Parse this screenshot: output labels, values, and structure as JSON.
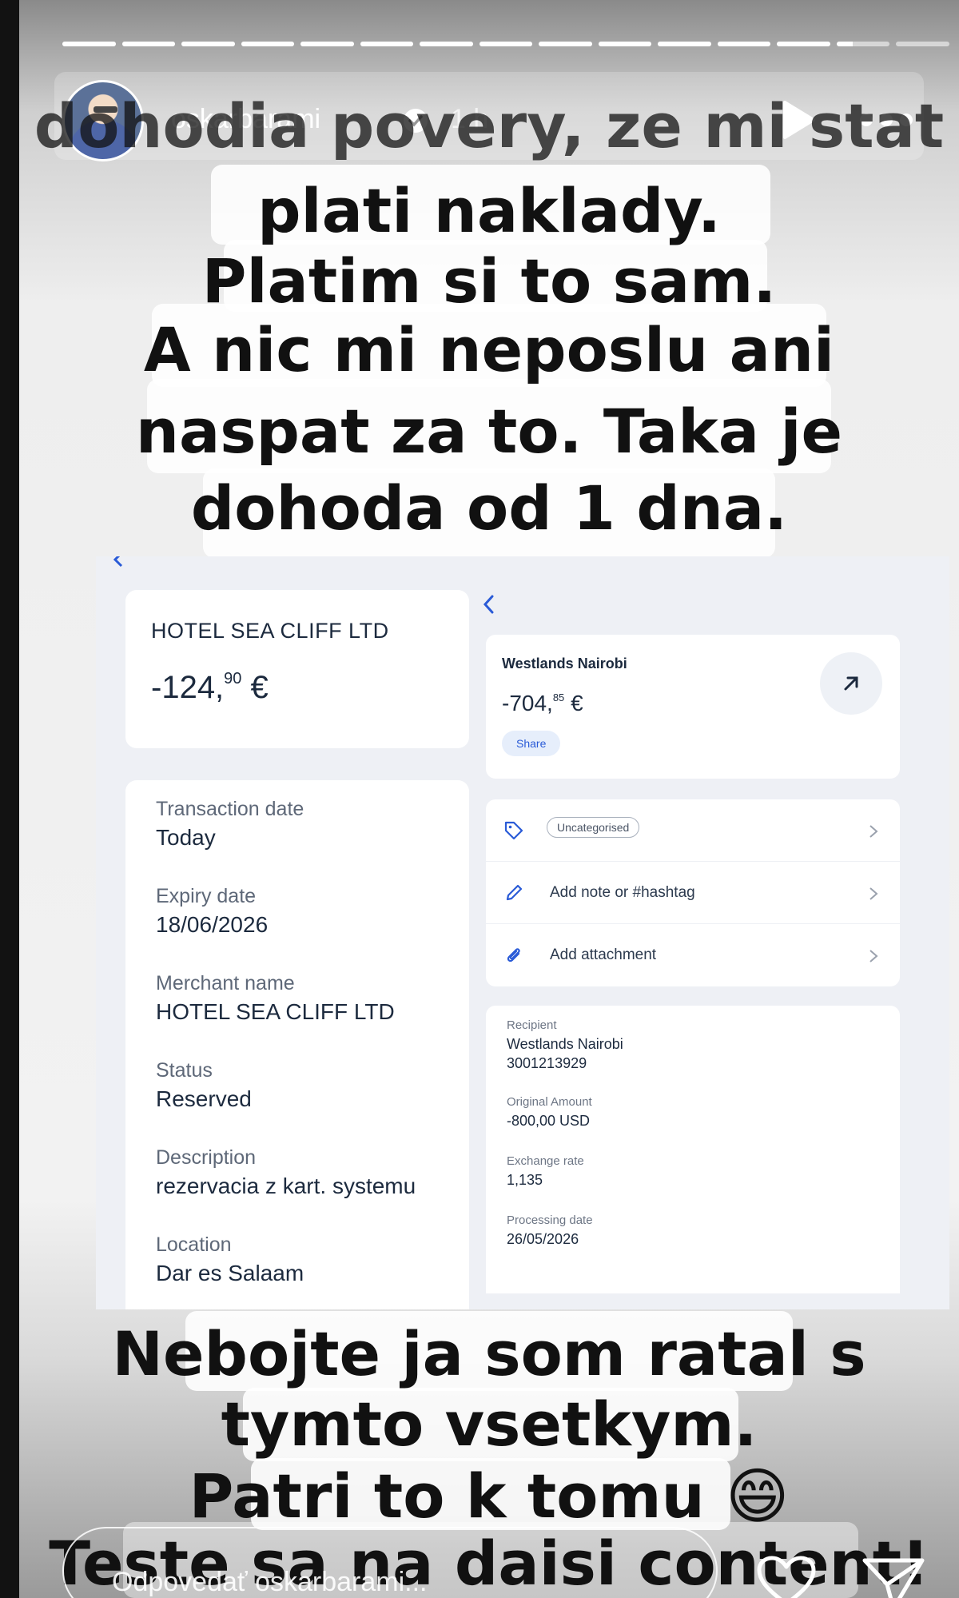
{
  "story": {
    "progress_segments": 15,
    "current_segment": 14,
    "current_segment_fill": 0.3
  },
  "header": {
    "username": "oskarbarami",
    "time": "1 h"
  },
  "caption_top": {
    "lines": [
      "dohodia povery, ze mi stat",
      "plati naklady.",
      "Platim si to sam.",
      "A nic mi neposlu ani",
      "naspat za to. Taka je",
      "dohoda od 1 dna."
    ]
  },
  "left_panel": {
    "merchant": "HOTEL SEA CLIFF LTD",
    "amount_int": "-124,",
    "amount_dec": "90",
    "amount_cur": " €",
    "details": [
      {
        "label": "Transaction date",
        "value": "Today"
      },
      {
        "label": "Expiry date",
        "value": "18/06/2026"
      },
      {
        "label": "Merchant name",
        "value": "HOTEL SEA CLIFF LTD"
      },
      {
        "label": "Status",
        "value": "Reserved"
      },
      {
        "label": "Description",
        "value": "rezervacia z kart. systemu"
      },
      {
        "label": "Location",
        "value": "Dar es Salaam"
      }
    ]
  },
  "right_panel": {
    "merchant": "Westlands Nairobi",
    "amount_int": "-704,",
    "amount_dec": "85",
    "amount_cur": " €",
    "share_label": "Share",
    "category_label": "Uncategorised",
    "note_label": "Add note or #hashtag",
    "attachment_label": "Add attachment",
    "details": [
      {
        "label": "Recipient",
        "value": "Westlands Nairobi",
        "value2": "3001213929"
      },
      {
        "label": "Original Amount",
        "value": "-800,00 USD"
      },
      {
        "label": "Exchange rate",
        "value": "1,135"
      },
      {
        "label": "Processing date",
        "value": "26/05/2026"
      }
    ]
  },
  "caption_bottom": {
    "lines": [
      "Nebojte ja som ratal s",
      "tymto vsetkym.",
      "Patri to k tomu 😄",
      "Teste sa na daisi content!"
    ]
  },
  "reply": {
    "placeholder": "Odpovedať oskarbarami..."
  }
}
